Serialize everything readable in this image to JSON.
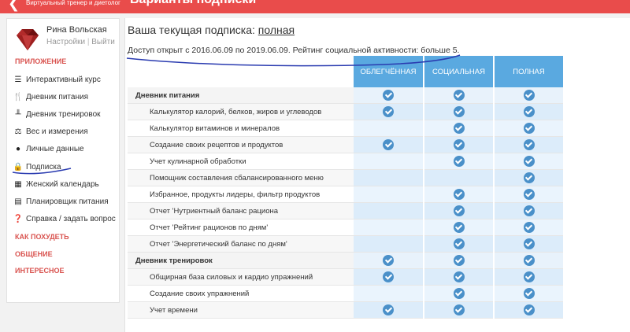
{
  "app": {
    "logo_text": "Виртуальный тренер и диетолог",
    "top_title": "Варианты подписки"
  },
  "user": {
    "name": "Рина Вольская",
    "settings": "Настройки",
    "separator": "|",
    "logout": "Выйти"
  },
  "sidebar": {
    "section_app": "ПРИЛОЖЕНИЕ",
    "items": [
      {
        "label": "Интерактивный курс",
        "icon": "list-icon"
      },
      {
        "label": "Дневник питания",
        "icon": "fork-knife-icon"
      },
      {
        "label": "Дневник тренировок",
        "icon": "dumbbell-icon"
      },
      {
        "label": "Вес и измерения",
        "icon": "scale-icon"
      },
      {
        "label": "Личные данные",
        "icon": "users-icon"
      },
      {
        "label": "Подписка",
        "icon": "lock-icon"
      },
      {
        "label": "Женский календарь",
        "icon": "calendar-icon"
      },
      {
        "label": "Планировщик питания",
        "icon": "document-icon"
      },
      {
        "label": "Справка / задать вопрос",
        "icon": "question-icon"
      }
    ],
    "section_lose": "КАК ПОХУДЕТЬ",
    "section_social": "ОБЩЕНИЕ",
    "section_interesting": "ИНТЕРЕСНОЕ"
  },
  "main": {
    "heading_prefix": "Ваша текущая подписка:",
    "heading_plan": "полная",
    "access_text": "Доступ открыт с 2016.06.09 по 2019.06.09. Рейтинг социальной активности: больше 5."
  },
  "plans": [
    "ОБЛЕГЧЁННАЯ",
    "СОЦИАЛЬНАЯ",
    "ПОЛНАЯ"
  ],
  "colors": {
    "accent_red": "#e94c4b",
    "table_header_blue": "#5aa9e0",
    "check_blue": "#4a90c9"
  },
  "rows": [
    {
      "type": "section",
      "label": "Дневник питания",
      "checks": [
        true,
        true,
        true
      ]
    },
    {
      "type": "feature",
      "label": "Калькулятор калорий, белков, жиров и углеводов",
      "checks": [
        true,
        true,
        true
      ]
    },
    {
      "type": "feature",
      "label": "Калькулятор витаминов и минералов",
      "checks": [
        false,
        true,
        true
      ]
    },
    {
      "type": "feature",
      "label": "Создание своих рецептов и продуктов",
      "checks": [
        true,
        true,
        true
      ]
    },
    {
      "type": "feature",
      "label": "Учет кулинарной обработки",
      "checks": [
        false,
        true,
        true
      ]
    },
    {
      "type": "feature",
      "label": "Помощник составления сбалансированного меню",
      "checks": [
        false,
        false,
        true
      ]
    },
    {
      "type": "feature",
      "label": "Избранное, продукты лидеры, фильтр продуктов",
      "checks": [
        false,
        true,
        true
      ]
    },
    {
      "type": "feature",
      "label": "Отчет 'Нутриентный баланс рациона",
      "checks": [
        false,
        true,
        true
      ]
    },
    {
      "type": "feature",
      "label": "Отчет 'Рейтинг рационов по дням'",
      "checks": [
        false,
        true,
        true
      ]
    },
    {
      "type": "feature",
      "label": "Отчет 'Энергетический баланс по дням'",
      "checks": [
        false,
        true,
        true
      ]
    },
    {
      "type": "section",
      "label": "Дневник тренировок",
      "checks": [
        true,
        true,
        true
      ]
    },
    {
      "type": "feature",
      "label": "Общирная база силовых и кардио упражнений",
      "checks": [
        true,
        true,
        true
      ]
    },
    {
      "type": "feature",
      "label": "Создание своих упражнений",
      "checks": [
        false,
        true,
        true
      ]
    },
    {
      "type": "feature",
      "label": "Учет времени",
      "checks": [
        true,
        true,
        true
      ]
    }
  ]
}
